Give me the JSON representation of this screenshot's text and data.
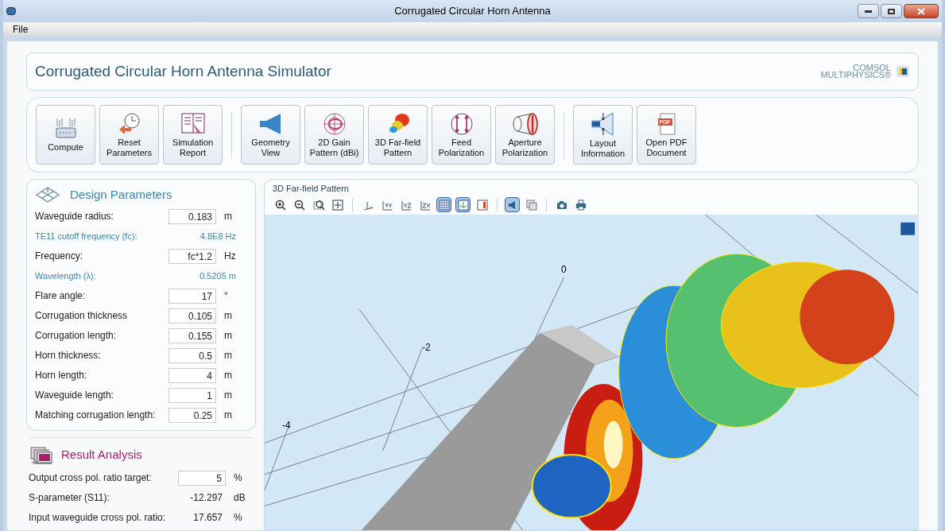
{
  "window": {
    "title": "Corrugated Circular Horn Antenna"
  },
  "menu": [
    "File"
  ],
  "header": {
    "title": "Corrugated Circular Horn Antenna Simulator",
    "logo_line1": "COMSOL",
    "logo_line2": "MULTIPHYSICS®"
  },
  "ribbon_groups": [
    {
      "buttons": [
        {
          "label": "Compute",
          "kind": "compute"
        },
        {
          "label": "Reset Parameters",
          "kind": "reset"
        },
        {
          "label": "Simulation Report",
          "kind": "report"
        }
      ]
    },
    {
      "buttons": [
        {
          "label": "Geometry View",
          "kind": "geometry"
        },
        {
          "label": "2D Gain Pattern (dBi)",
          "kind": "polar"
        },
        {
          "label": "3D Far-field Pattern",
          "kind": "farfield"
        },
        {
          "label": "Feed Polarization",
          "kind": "feed"
        },
        {
          "label": "Aperture Polarization",
          "kind": "aperture"
        }
      ]
    },
    {
      "buttons": [
        {
          "label": "Layout Information",
          "kind": "layout"
        },
        {
          "label": "Open PDF Document",
          "kind": "pdf",
          "badge": "PDF"
        }
      ]
    }
  ],
  "design_parameters": {
    "title": "Design Parameters",
    "rows": [
      {
        "label": "Waveguide radius:",
        "value": "0.183",
        "unit": "m",
        "kind": "input"
      },
      {
        "label": "TE11 cutoff frequency (fc):",
        "value": "4.8E8 Hz",
        "kind": "derived"
      },
      {
        "label": "Frequency:",
        "value": "fc*1.2",
        "unit": "Hz",
        "kind": "input"
      },
      {
        "label": "Wavelength (λ):",
        "value": "0.5205 m",
        "kind": "derived"
      },
      {
        "label": "Flare angle:",
        "value": "17",
        "unit": "°",
        "kind": "input"
      },
      {
        "label": "Corrugation thickness",
        "value": "0.105",
        "unit": "m",
        "kind": "input"
      },
      {
        "label": "Corrugation length:",
        "value": "0.155",
        "unit": "m",
        "kind": "input"
      },
      {
        "label": "Horn thickness:",
        "value": "0.5",
        "unit": "m",
        "kind": "input"
      },
      {
        "label": "Horn length:",
        "value": "4",
        "unit": "m",
        "kind": "input"
      },
      {
        "label": "Waveguide length:",
        "value": "1",
        "unit": "m",
        "kind": "input"
      },
      {
        "label": "Matching corrugation length:",
        "value": "0.25",
        "unit": "m",
        "kind": "input"
      }
    ]
  },
  "result_analysis": {
    "title": "Result Analysis",
    "rows": [
      {
        "label": "Output cross pol. ratio target:",
        "value": "5",
        "unit": "%",
        "kind": "input"
      },
      {
        "label": "S-parameter (S11):",
        "value": "-12.297",
        "unit": "dB",
        "kind": "output"
      },
      {
        "label": "Input waveguide cross pol. ratio:",
        "value": "17.657",
        "unit": "%",
        "kind": "output"
      }
    ]
  },
  "graphics": {
    "title": "3D Far-field Pattern",
    "toolbar": [
      {
        "kind": "zoom-in",
        "selected": false
      },
      {
        "kind": "zoom-out",
        "selected": false
      },
      {
        "kind": "zoom-box",
        "selected": false
      },
      {
        "kind": "zoom-extents",
        "selected": false
      },
      {
        "kind": "sep"
      },
      {
        "kind": "axes",
        "selected": false
      },
      {
        "kind": "xy",
        "selected": false
      },
      {
        "kind": "yz",
        "selected": false
      },
      {
        "kind": "zx",
        "selected": false
      },
      {
        "kind": "grid",
        "selected": true
      },
      {
        "kind": "axis-orientation",
        "selected": true
      },
      {
        "kind": "legend",
        "selected": false
      },
      {
        "kind": "sep"
      },
      {
        "kind": "light",
        "selected": true
      },
      {
        "kind": "transparency",
        "selected": false
      },
      {
        "kind": "sep"
      },
      {
        "kind": "camera",
        "selected": false
      },
      {
        "kind": "print",
        "selected": false
      }
    ],
    "axis_labels": [
      "0",
      "-2",
      "-4"
    ]
  }
}
